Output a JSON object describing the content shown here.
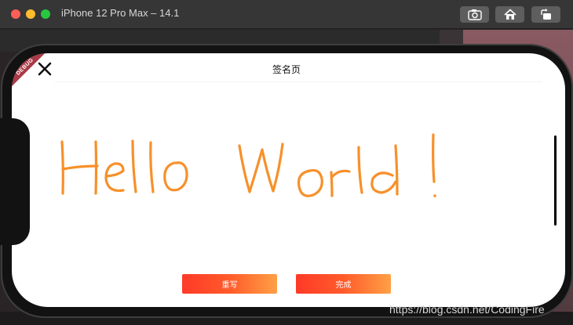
{
  "window": {
    "title": "iPhone 12 Pro Max – 14.1",
    "toolbar_icons": [
      "screenshot-icon",
      "home-icon",
      "rotate-icon"
    ]
  },
  "app": {
    "debug_banner": "DEBUG",
    "page_title": "签名页",
    "close_icon": "close-icon",
    "signature_text": "Hello World !",
    "signature_color": "#f7902a",
    "buttons": {
      "rewrite": "重写",
      "done": "完成"
    },
    "button_gradient": [
      "#ff3a28",
      "#ffa046"
    ]
  },
  "watermark": "https://blog.csdn.net/CodingFire"
}
